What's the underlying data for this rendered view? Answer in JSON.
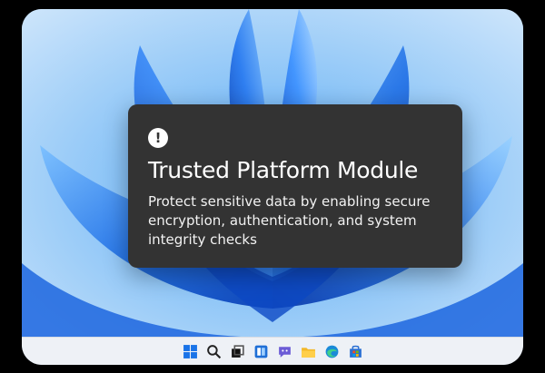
{
  "dialog": {
    "icon": "exclamation-icon",
    "title": "Trusted Platform Module",
    "message": "Protect sensitive data by enabling secure encryption, authentication, and system integrity checks"
  },
  "taskbar": {
    "icons": [
      "windows-start-icon",
      "search-icon",
      "task-view-icon",
      "widgets-icon",
      "chat-icon",
      "file-explorer-icon",
      "edge-browser-icon",
      "store-icon"
    ]
  },
  "colors": {
    "dialog_background": "#333333",
    "wallpaper_blue": "#1a6fe8",
    "taskbar_background": "#eef1f6"
  }
}
